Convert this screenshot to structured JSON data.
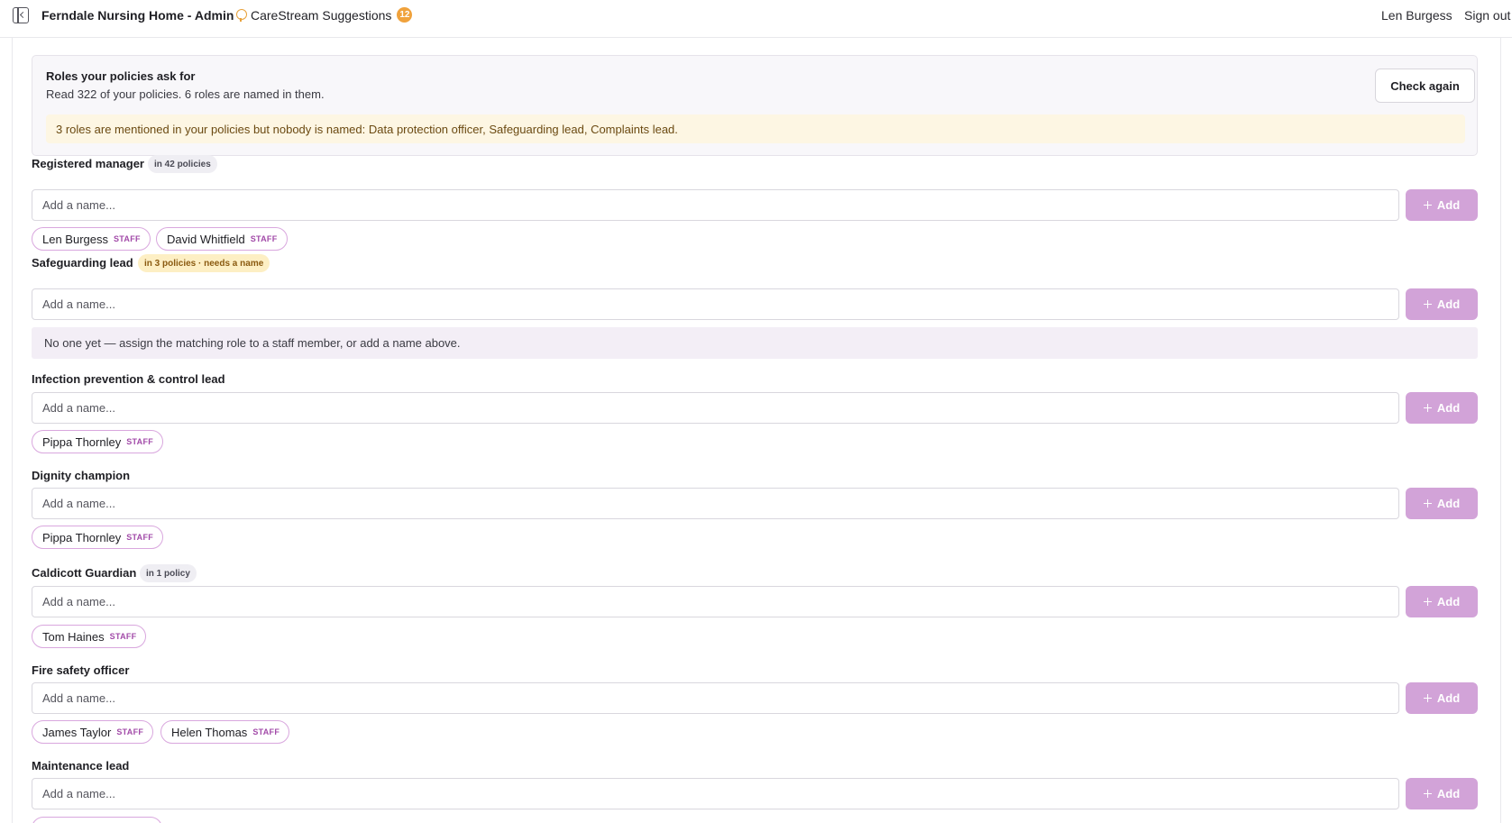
{
  "header": {
    "app_title": "Ferndale Nursing Home - Admin",
    "suggestions_label": "CareStream Suggestions",
    "suggestions_count": "12",
    "user_name": "Len Burgess",
    "sign_out_label": "Sign out"
  },
  "summary": {
    "title": "Roles your policies ask for",
    "text": "Read 322 of your policies. 6 roles are named in them.",
    "check_button": "Check again",
    "alert": "3 roles are mentioned in your policies but nobody is named: Data protection officer, Safeguarding lead, Complaints lead."
  },
  "input_placeholder": "Add a name...",
  "add_label": "Add",
  "staff_tag": "STAFF",
  "roles": [
    {
      "label": "Registered manager",
      "pill": "in 42 policies",
      "people": [
        "Len Burgess",
        "David Whitfield"
      ]
    },
    {
      "label": "Safeguarding lead",
      "pill": "in 3 policies · needs a name",
      "empty_note": "No one yet — assign the matching role to a staff member, or add a name above."
    },
    {
      "label": "Infection prevention & control lead",
      "people": [
        "Pippa Thornley"
      ]
    },
    {
      "label": "Dignity champion",
      "people": [
        "Pippa Thornley"
      ]
    },
    {
      "label": "Caldicott Guardian",
      "pill": "in 1 policy",
      "people": [
        "Tom Haines"
      ]
    },
    {
      "label": "Fire safety officer",
      "people": [
        "James Taylor",
        "Helen Thomas"
      ]
    },
    {
      "label": "Maintenance lead",
      "people": []
    }
  ],
  "colors": {
    "add_button": "#d2a3d8",
    "chip_border": "#d9a7de",
    "alert_bg": "#fdf6e3",
    "badge": "#f0a23c"
  }
}
